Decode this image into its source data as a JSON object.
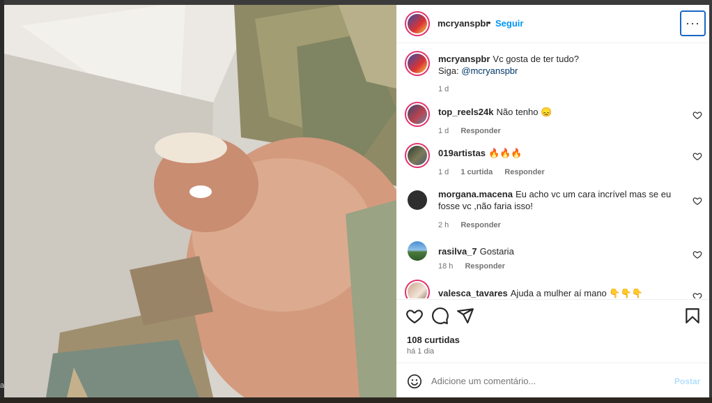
{
  "post": {
    "author": "mcryanspbr",
    "separator": "•",
    "follow_label": "Seguir",
    "more_label": "···",
    "caption_line1": "Vc gosta de ter tudo?",
    "caption_line2_prefix": "Siga:",
    "caption_mention": "@mcryanspbr",
    "caption_time": "1 d",
    "likes": "108 curtidas",
    "date": "há 1 dia"
  },
  "comments": [
    {
      "user": "top_reels24k",
      "text": "Não tenho 😞",
      "time": "1 d",
      "likes": "",
      "reply": "Responder"
    },
    {
      "user": "019artistas",
      "text": "🔥🔥🔥",
      "time": "1 d",
      "likes": "1 curtida",
      "reply": "Responder"
    },
    {
      "user": "morgana.macena",
      "text": "Eu acho vc um cara incrível mas se eu fosse vc ,não faria isso!",
      "time": "2 h",
      "likes": "",
      "reply": "Responder"
    },
    {
      "user": "rasilva_7",
      "text": "Gostaria",
      "time": "18 h",
      "likes": "",
      "reply": "Responder"
    },
    {
      "user": "valesca_tavares",
      "text": "Ajuda a mulher aí mano 👇👇👇",
      "time": "",
      "likes": "",
      "reply": ""
    }
  ],
  "composer": {
    "placeholder": "Adicione um comentário...",
    "post_label": "Postar"
  },
  "icons": {
    "like": "heart-icon",
    "comment": "comment-icon",
    "share": "share-icon",
    "save": "bookmark-icon",
    "emoji": "emoji-icon",
    "more": "more-options-icon"
  },
  "colors": {
    "accent": "#0095f6",
    "ring": "#e1306c",
    "text": "#262626",
    "muted": "#737373"
  },
  "edge_char": "a"
}
